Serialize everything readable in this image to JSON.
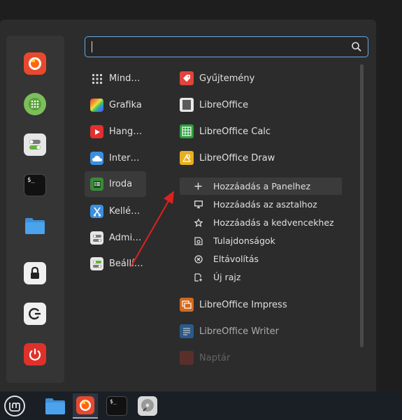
{
  "search": {
    "value": ""
  },
  "favorites": [
    {
      "name": "firefox",
      "icon": "firefox-icon"
    },
    {
      "name": "software-manager",
      "icon": "grid-dots-icon"
    },
    {
      "name": "settings",
      "icon": "toggle-icon"
    },
    {
      "name": "terminal",
      "icon": "terminal-icon",
      "glyph": "$_"
    },
    {
      "name": "files",
      "icon": "folder-icon"
    },
    {
      "name": "lock-screen",
      "icon": "lock-icon"
    },
    {
      "name": "logout",
      "icon": "logout-icon"
    },
    {
      "name": "shutdown",
      "icon": "power-icon"
    }
  ],
  "categories": [
    {
      "label": "Mind…",
      "icon": "all-apps-icon"
    },
    {
      "label": "Grafika",
      "icon": "graphics-icon"
    },
    {
      "label": "Hang…",
      "icon": "multimedia-icon"
    },
    {
      "label": "Inter…",
      "icon": "internet-icon"
    },
    {
      "label": "Iroda",
      "icon": "office-icon",
      "active": true
    },
    {
      "label": "Kellé…",
      "icon": "accessories-icon"
    },
    {
      "label": "Admi…",
      "icon": "administration-icon"
    },
    {
      "label": "Beállí…",
      "icon": "preferences-icon"
    }
  ],
  "apps": [
    {
      "label": "Gyűjtemény",
      "icon": "collection-icon",
      "color": "#e0443c"
    },
    {
      "label": "LibreOffice",
      "icon": "libreoffice-icon",
      "color": "#e8e8e8"
    },
    {
      "label": "LibreOffice Calc",
      "icon": "calc-icon",
      "color": "#2e9e3e"
    },
    {
      "label": "LibreOffice Draw",
      "icon": "draw-icon",
      "color": "#e8b020"
    },
    {
      "label": "LibreOffice Impress",
      "icon": "impress-icon",
      "color": "#d2691e"
    },
    {
      "label": "LibreOffice Writer",
      "icon": "writer-icon",
      "color": "#2a6eb5"
    },
    {
      "label": "Naptár",
      "icon": "calendar-icon",
      "color": "#c0392b"
    }
  ],
  "context_menu": [
    {
      "label": "Hozzáadás a Panelhez",
      "icon": "plus-icon"
    },
    {
      "label": "Hozzáadás az asztalhoz",
      "icon": "desktop-icon"
    },
    {
      "label": "Hozzáadás a kedvencekhez",
      "icon": "star-icon"
    },
    {
      "label": "Tulajdonságok",
      "icon": "properties-icon"
    },
    {
      "label": "Eltávolítás",
      "icon": "remove-icon"
    },
    {
      "label": "Új rajz",
      "icon": "new-drawing-icon"
    }
  ],
  "taskbar": [
    {
      "name": "menu",
      "icon": "mint-logo-icon"
    },
    {
      "name": "files",
      "icon": "folder-icon"
    },
    {
      "name": "firefox",
      "icon": "firefox-icon",
      "active": true
    },
    {
      "name": "terminal",
      "icon": "terminal-icon",
      "glyph": "$_"
    },
    {
      "name": "disks",
      "icon": "disk-icon"
    }
  ],
  "colors": {
    "accent": "#6aa9e0",
    "arrow": "#e02020",
    "background": "#2c2c2c"
  }
}
